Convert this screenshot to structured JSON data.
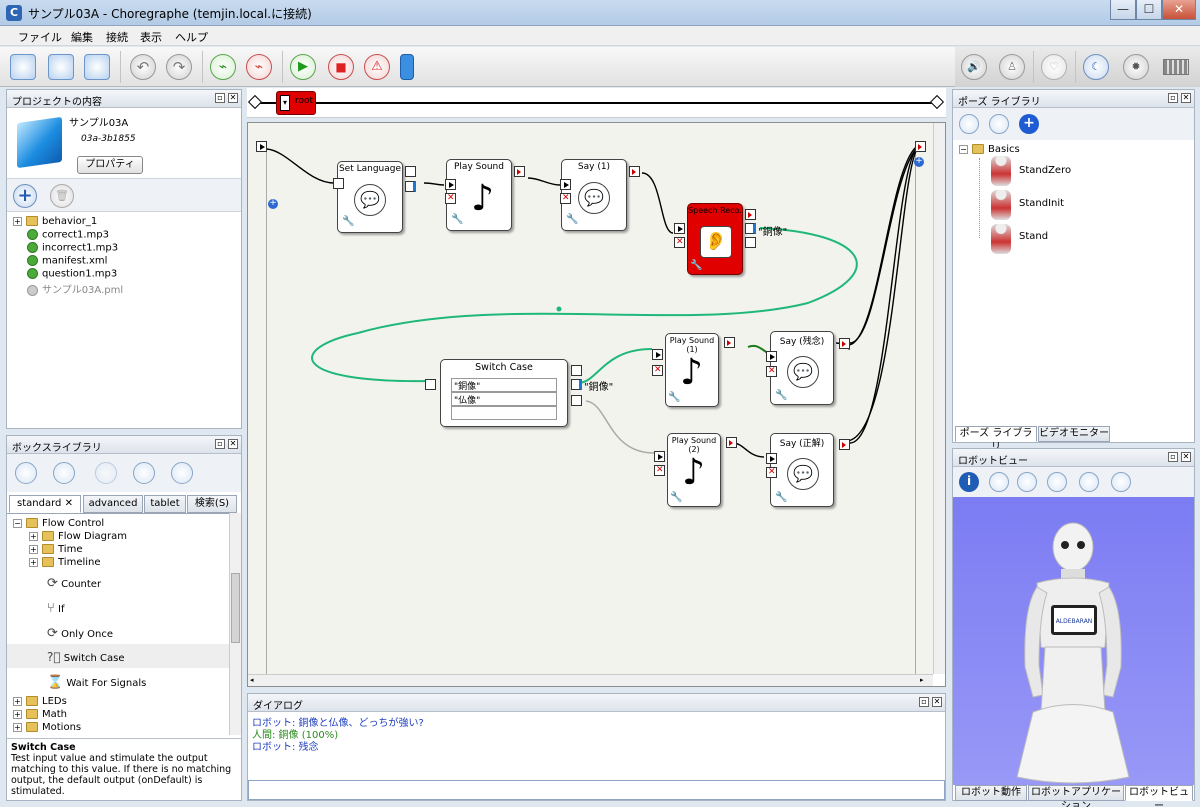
{
  "window": {
    "title": "サンプル03A - Choregraphe (temjin.local.に接続)",
    "app_icon": "C",
    "min": "—",
    "max": "☐",
    "close": "✕"
  },
  "menu": [
    "ファイル",
    "編集",
    "接続",
    "表示",
    "ヘルプ"
  ],
  "project": {
    "panel_title": "プロジェクトの内容",
    "name": "サンプル03A",
    "id": "03a-3b1855",
    "properties_button": "プロパティ",
    "files": [
      "behavior_1",
      "correct1.mp3",
      "incorrect1.mp3",
      "manifest.xml",
      "question1.mp3",
      "サンプル03A.pml"
    ]
  },
  "box_library": {
    "panel_title": "ボックスライブラリ",
    "tabs": [
      "standard",
      "advanced",
      "tablet",
      "検索(S)"
    ],
    "tree": [
      "Flow Control",
      "Flow Diagram",
      "Time",
      "Timeline",
      "Counter",
      "If",
      "Only Once",
      "Switch Case",
      "Wait For Signals",
      "LEDs",
      "Math",
      "Motions"
    ],
    "description_title": "Switch Case",
    "description_text": "Test input value and stimulate the output matching to this value. If there is no matching output, the default output (onDefault) is stimulated."
  },
  "breadcrumb": {
    "root": "root"
  },
  "flow": {
    "boxes": {
      "set_language": "Set Language",
      "play_sound": "Play Sound",
      "say1": "Say (1)",
      "speech_reco": "Speech Reco.",
      "switch_case": "Switch Case",
      "play_sound1": "Play Sound (1)",
      "say_zannen": "Say (残念)",
      "play_sound2": "Play Sound (2)",
      "say_seikai": "Say (正解)"
    },
    "speech_output": "\"銅像\"",
    "switch_output": "\"銅像\"",
    "switch_rows": [
      "\"銅像\"",
      "\"仏像\"",
      ""
    ]
  },
  "dialog": {
    "panel_title": "ダイアログ",
    "lines": [
      {
        "text": "ロボット: 銅像と仏像、どっちが強い?",
        "color": "#1f3fbf"
      },
      {
        "text": "人間: 銅像 (100%)",
        "color": "#2b8a1e"
      },
      {
        "text": "ロボット: 残念",
        "color": "#1f3fbf"
      }
    ]
  },
  "pose_library": {
    "panel_title": "ポーズ ライブラリ",
    "folder": "Basics",
    "poses": [
      "StandZero",
      "StandInit",
      "Stand"
    ],
    "tabs": [
      "ポーズ ライブラリ",
      "ビデオモニター"
    ]
  },
  "robot_view": {
    "panel_title": "ロボットビュー",
    "chest_logo": "ALDEBARAN",
    "tabs": [
      "ロボット動作",
      "ロボットアプリケーション",
      "ロボットビュー"
    ]
  },
  "colors": {
    "speech_box": "#e00000",
    "link_green": "#1fb878",
    "sky": "#8080f5"
  }
}
